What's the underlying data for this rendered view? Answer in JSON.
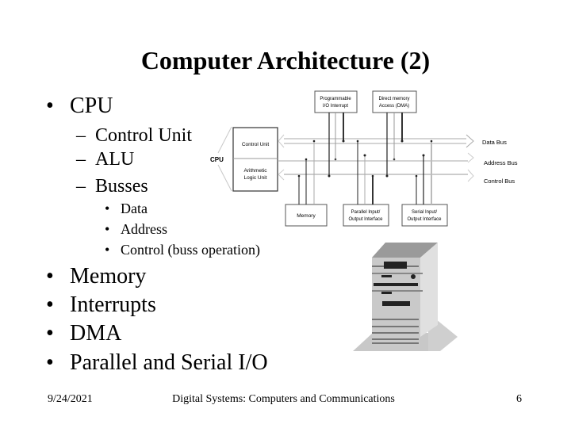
{
  "slide": {
    "title": "Computer Architecture (2)",
    "bullets": [
      {
        "level": 1,
        "marker": "•",
        "text": "CPU"
      },
      {
        "level": 2,
        "marker": "–",
        "text": "Control Unit"
      },
      {
        "level": 2,
        "marker": "–",
        "text": "ALU"
      },
      {
        "level": 2,
        "marker": "–",
        "text": "Busses"
      },
      {
        "level": 3,
        "marker": "•",
        "text": "Data"
      },
      {
        "level": 3,
        "marker": "•",
        "text": "Address"
      },
      {
        "level": 3,
        "marker": "•",
        "text": "Control (buss operation)"
      },
      {
        "level": 1,
        "marker": "•",
        "text": "Memory"
      },
      {
        "level": 1,
        "marker": "•",
        "text": "Interrupts"
      },
      {
        "level": 1,
        "marker": "•",
        "text": "DMA"
      },
      {
        "level": 1,
        "marker": "•",
        "text": "Parallel and Serial I/O"
      }
    ],
    "footer": {
      "date": "9/24/2021",
      "course": "Digital Systems: Computers and Communications",
      "page": "6"
    }
  },
  "diagram": {
    "cpu_label": "CPU",
    "control_unit": "Control Unit",
    "alu_line1": "Arithmetic",
    "alu_line2": "Logic Unit",
    "pic_line1": "Programmable",
    "pic_line2": "I/O Interrupt",
    "dma_line1": "Direct memory",
    "dma_line2": "Access (DMA)",
    "memory": "Memory",
    "parallel_line1": "Parallel Input/",
    "parallel_line2": "Output Interface",
    "serial_line1": "Serial Input/",
    "serial_line2": "Output Interface",
    "data_bus": "Data Bus",
    "address_bus": "Address Bus",
    "control_bus": "Control Bus"
  },
  "illustration": {
    "name": "computer tower"
  }
}
